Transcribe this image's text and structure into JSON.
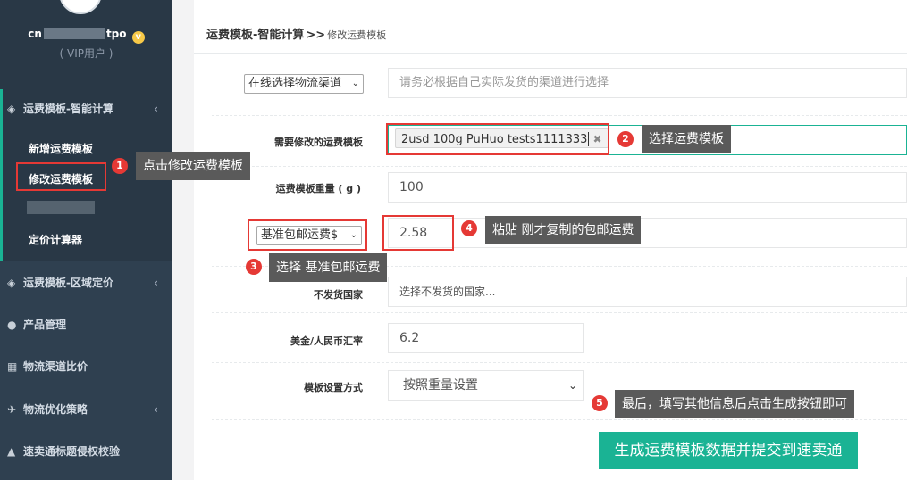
{
  "sidebar": {
    "user": {
      "name_prefix": "cn",
      "name_suffix": "tpo",
      "vip_mark": "v",
      "role": "( VIP用户 )"
    },
    "sections": [
      {
        "icon": "◈",
        "label": "运费模板-智能计算",
        "arrow": "‹"
      },
      {
        "icon": "◈",
        "label": "运费模板-区域定价",
        "arrow": "‹"
      },
      {
        "icon": "●",
        "label": "产品管理",
        "arrow": ""
      },
      {
        "icon": "▦",
        "label": "物流渠道比价",
        "arrow": ""
      },
      {
        "icon": "✈",
        "label": "物流优化策略",
        "arrow": "‹"
      },
      {
        "icon": "▲",
        "label": "速卖通标题侵权校验",
        "arrow": ""
      }
    ],
    "submenu": [
      "新增运费模板",
      "修改运费模板",
      "定价计算器"
    ]
  },
  "breadcrumb": {
    "title": "运费模板-智能计算",
    "sep": ">>",
    "sub": "修改运费模板"
  },
  "form": {
    "channel_select": "在线选择物流渠道",
    "channel_hint": "请务必根据自己实际发货的渠道进行选择",
    "template_label": "需要修改的运费模板",
    "template_tag": "2usd 100g PuHuo tests1111333",
    "weight_label": "运费模板重量 ( g )",
    "weight_value": "100",
    "fee_select": "基准包邮运费$",
    "fee_value": "2.58",
    "exclude_label": "不发货国家",
    "exclude_placeholder": "选择不发货的国家...",
    "rate_label": "美金/人民币汇率",
    "rate_value": "6.2",
    "mode_label": "模板设置方式",
    "mode_value": "按照重量设置",
    "submit_label": "生成运费模板数据并提交到速卖通"
  },
  "annotations": [
    {
      "num": "1",
      "text": "点击修改运费模板"
    },
    {
      "num": "2",
      "text": "选择运费模板"
    },
    {
      "num": "3",
      "text": "选择 基准包邮运费"
    },
    {
      "num": "4",
      "text": "粘贴 刚才复制的包邮运费"
    },
    {
      "num": "5",
      "text": "最后，填写其他信息后点击生成按钮即可"
    }
  ]
}
